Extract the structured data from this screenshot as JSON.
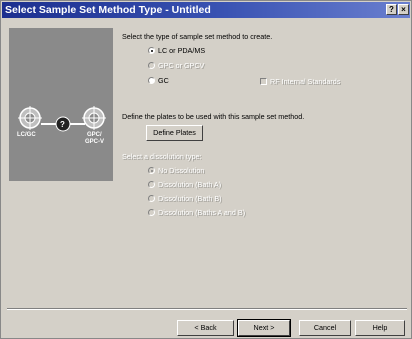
{
  "window": {
    "title": "Select Sample Set Method Type - Untitled",
    "help_glyph": "?",
    "close_glyph": "×"
  },
  "diagram": {
    "left_label": "LC/GC",
    "right_label_line1": "GPC/",
    "right_label_line2": "GPC-V",
    "question_glyph": "?"
  },
  "method": {
    "prompt": "Select the type of sample set method to create.",
    "options": [
      {
        "label": "LC or PDA/MS",
        "selected": true,
        "enabled": true
      },
      {
        "label": "GPC or GPCV",
        "selected": false,
        "enabled": false
      },
      {
        "label": "GC",
        "selected": false,
        "enabled": true
      }
    ],
    "internal_standards_label": "RF Internal Standards",
    "internal_standards_checked": false
  },
  "plates": {
    "prompt": "Define the plates to be used with this sample set method.",
    "button_label": "Define Plates"
  },
  "dissolution": {
    "prompt": "Select a dissolution type:",
    "options": [
      {
        "label": "No Dissolution",
        "selected": true
      },
      {
        "label": "Dissolution (Bath A)",
        "selected": false
      },
      {
        "label": "Dissolution (Bath B)",
        "selected": false
      },
      {
        "label": "Dissolution (Baths A and B)",
        "selected": false
      }
    ]
  },
  "footer": {
    "back": "< Back",
    "next": "Next >",
    "cancel": "Cancel",
    "help": "Help"
  }
}
